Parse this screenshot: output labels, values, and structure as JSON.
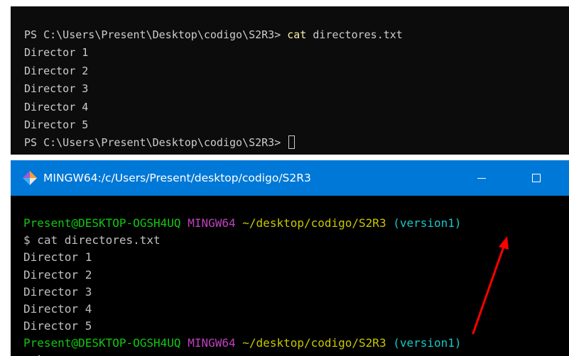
{
  "powershell": {
    "prompt": "PS C:\\Users\\Present\\Desktop\\codigo\\S2R3>",
    "command": "cat",
    "argument": "directores.txt",
    "output": [
      "Director 1",
      "Director 2",
      "Director 3",
      "Director 4",
      "Director 5"
    ],
    "prompt2": "PS C:\\Users\\Present\\Desktop\\codigo\\S2R3>"
  },
  "mingw": {
    "title": "MINGW64:/c/Users/Present/desktop/codigo/S2R3",
    "icon": "git-bash-icon",
    "minimize_symbol": "—",
    "maximize_symbol": "☐",
    "prompt": {
      "user": "Present@DESKTOP-OGSH4UQ",
      "system": "MINGW64",
      "path": "~/desktop/codigo/S2R3",
      "branch": "(version1)"
    },
    "command": "$ cat directores.txt",
    "output": [
      "Director 1",
      "Director 2",
      "Director 3",
      "Director 4",
      "Director 5"
    ],
    "prompt2": {
      "user": "Present@DESKTOP-OGSH4UQ",
      "system": "MINGW64",
      "path": "~/desktop/codigo/S2R3",
      "branch": "(version1)"
    },
    "input_prompt": "$"
  },
  "colors": {
    "titlebar": "#0078d7",
    "user": "#11c811",
    "system": "#bf40bf",
    "path": "#c8c800",
    "branch": "#18c8c8",
    "annotation_arrow": "#ff0000"
  }
}
